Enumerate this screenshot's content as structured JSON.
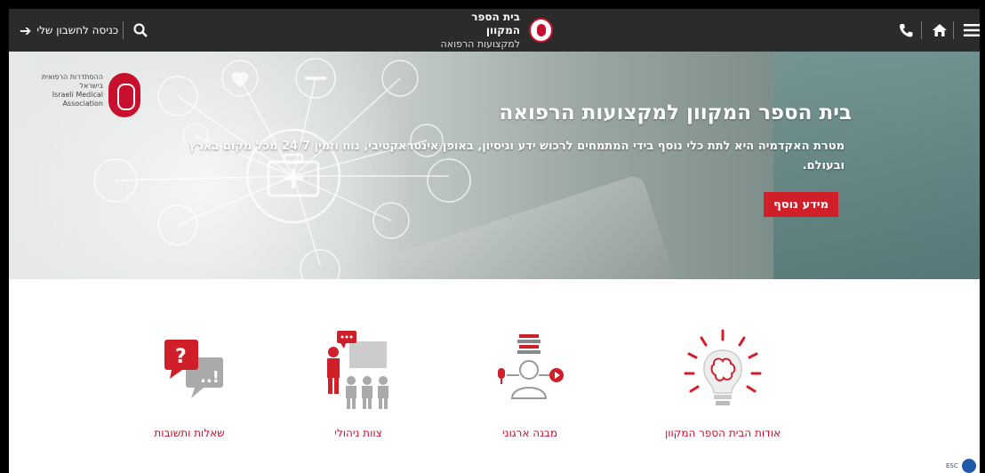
{
  "topbar": {
    "login_label": "כניסה לחשבון שלי",
    "login_icon": "sign-in-icon",
    "search_icon": "search-icon",
    "logo_line1": "בית הספר המקוון",
    "logo_line2": "למקצועות הרפואה",
    "phone_icon": "phone-icon",
    "home_icon": "home-icon",
    "menu_icon": "hamburger-menu-icon",
    "background": "#2b2b2b"
  },
  "hero": {
    "org_name": "ההסתדרות הרפואית בישראל",
    "org_name_en_1": "Israeli Medical",
    "org_name_en_2": "Association",
    "title": "בית הספר המקוון למקצועות הרפואה",
    "description": "מטרת האקדמיה היא לתת כלי נוסף בידי המתמחים לרכוש ידע וניסיון, באופן אינטראקטיבי, נוח וזמין 24/7 מכל מקום בארץ ובעולם.",
    "button_label": "מידע נוסף"
  },
  "features": [
    {
      "label": "אודות הבית הספר המקוון",
      "icon": "lightbulb-brain-icon"
    },
    {
      "label": "מבנה ארגוני",
      "icon": "org-structure-icon"
    },
    {
      "label": "צוות ניהולי",
      "icon": "management-team-icon"
    },
    {
      "label": "שאלות ותשובות",
      "icon": "questions-answers-icon"
    }
  ],
  "footer": {
    "esc_label": "ESC",
    "accessibility_icon": "accessibility-icon"
  },
  "colors": {
    "accent": "#c8102e",
    "button": "#d11f2a"
  }
}
